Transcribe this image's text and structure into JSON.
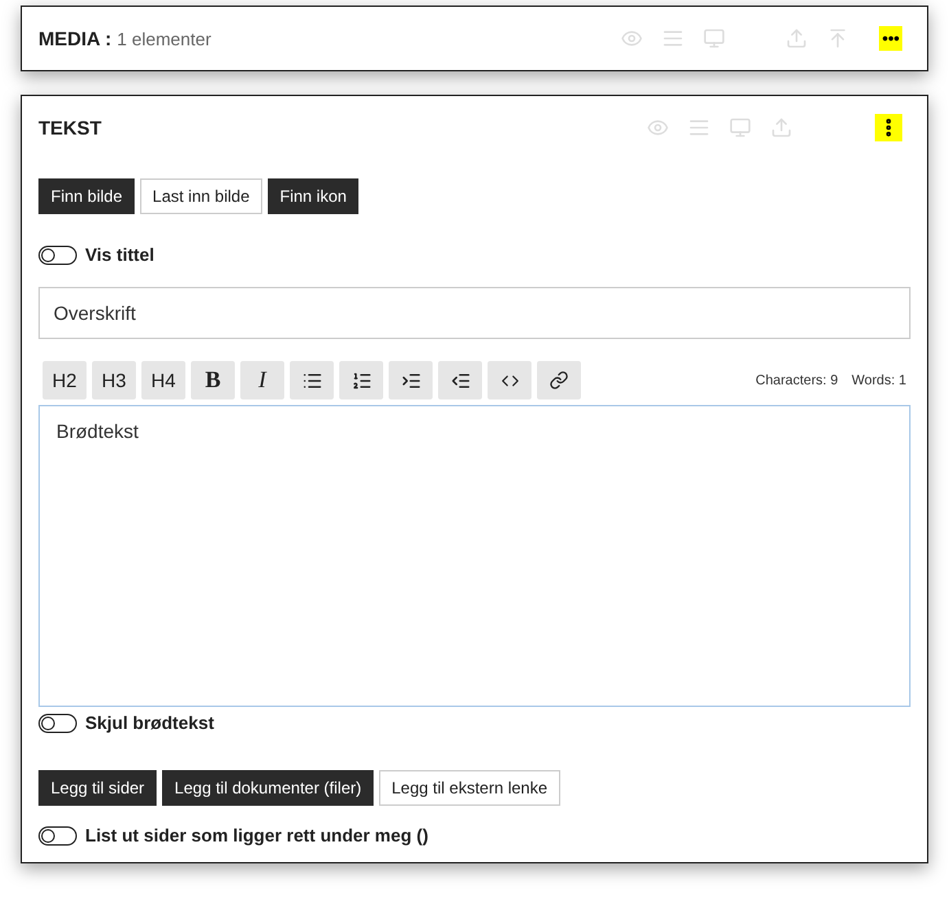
{
  "media_panel": {
    "title": "MEDIA :",
    "count": "1 elementer",
    "menu": "•••"
  },
  "text_panel": {
    "title": "TEKST",
    "image_buttons": [
      {
        "label": "Finn bilde",
        "kind": "dark"
      },
      {
        "label": "Last inn bilde",
        "kind": "light"
      },
      {
        "label": "Finn ikon",
        "kind": "dark"
      }
    ],
    "show_title": {
      "label": "Vis tittel",
      "on": false
    },
    "heading_field": {
      "value": "Overskrift"
    },
    "toolbar": [
      {
        "kind": "text",
        "label": "H2"
      },
      {
        "kind": "text",
        "label": "H3"
      },
      {
        "kind": "text",
        "label": "H4"
      },
      {
        "kind": "bold",
        "label": "B"
      },
      {
        "kind": "italic",
        "label": "I"
      },
      {
        "kind": "bullets"
      },
      {
        "kind": "numbers"
      },
      {
        "kind": "indent"
      },
      {
        "kind": "outdent"
      },
      {
        "kind": "code"
      },
      {
        "kind": "link"
      }
    ],
    "characters": "Characters: 9",
    "words": "Words: 1",
    "body": "Brødtekst",
    "hide_body": {
      "label": "Skjul brødtekst",
      "on": false
    },
    "link_buttons": [
      {
        "label": "Legg til sider",
        "kind": "dark"
      },
      {
        "label": "Legg til dokumenter (filer)",
        "kind": "dark"
      },
      {
        "label": "Legg til ekstern lenke",
        "kind": "light"
      }
    ],
    "list_pages": {
      "label": "List ut sider som ligger rett under meg ()",
      "on": false
    }
  }
}
